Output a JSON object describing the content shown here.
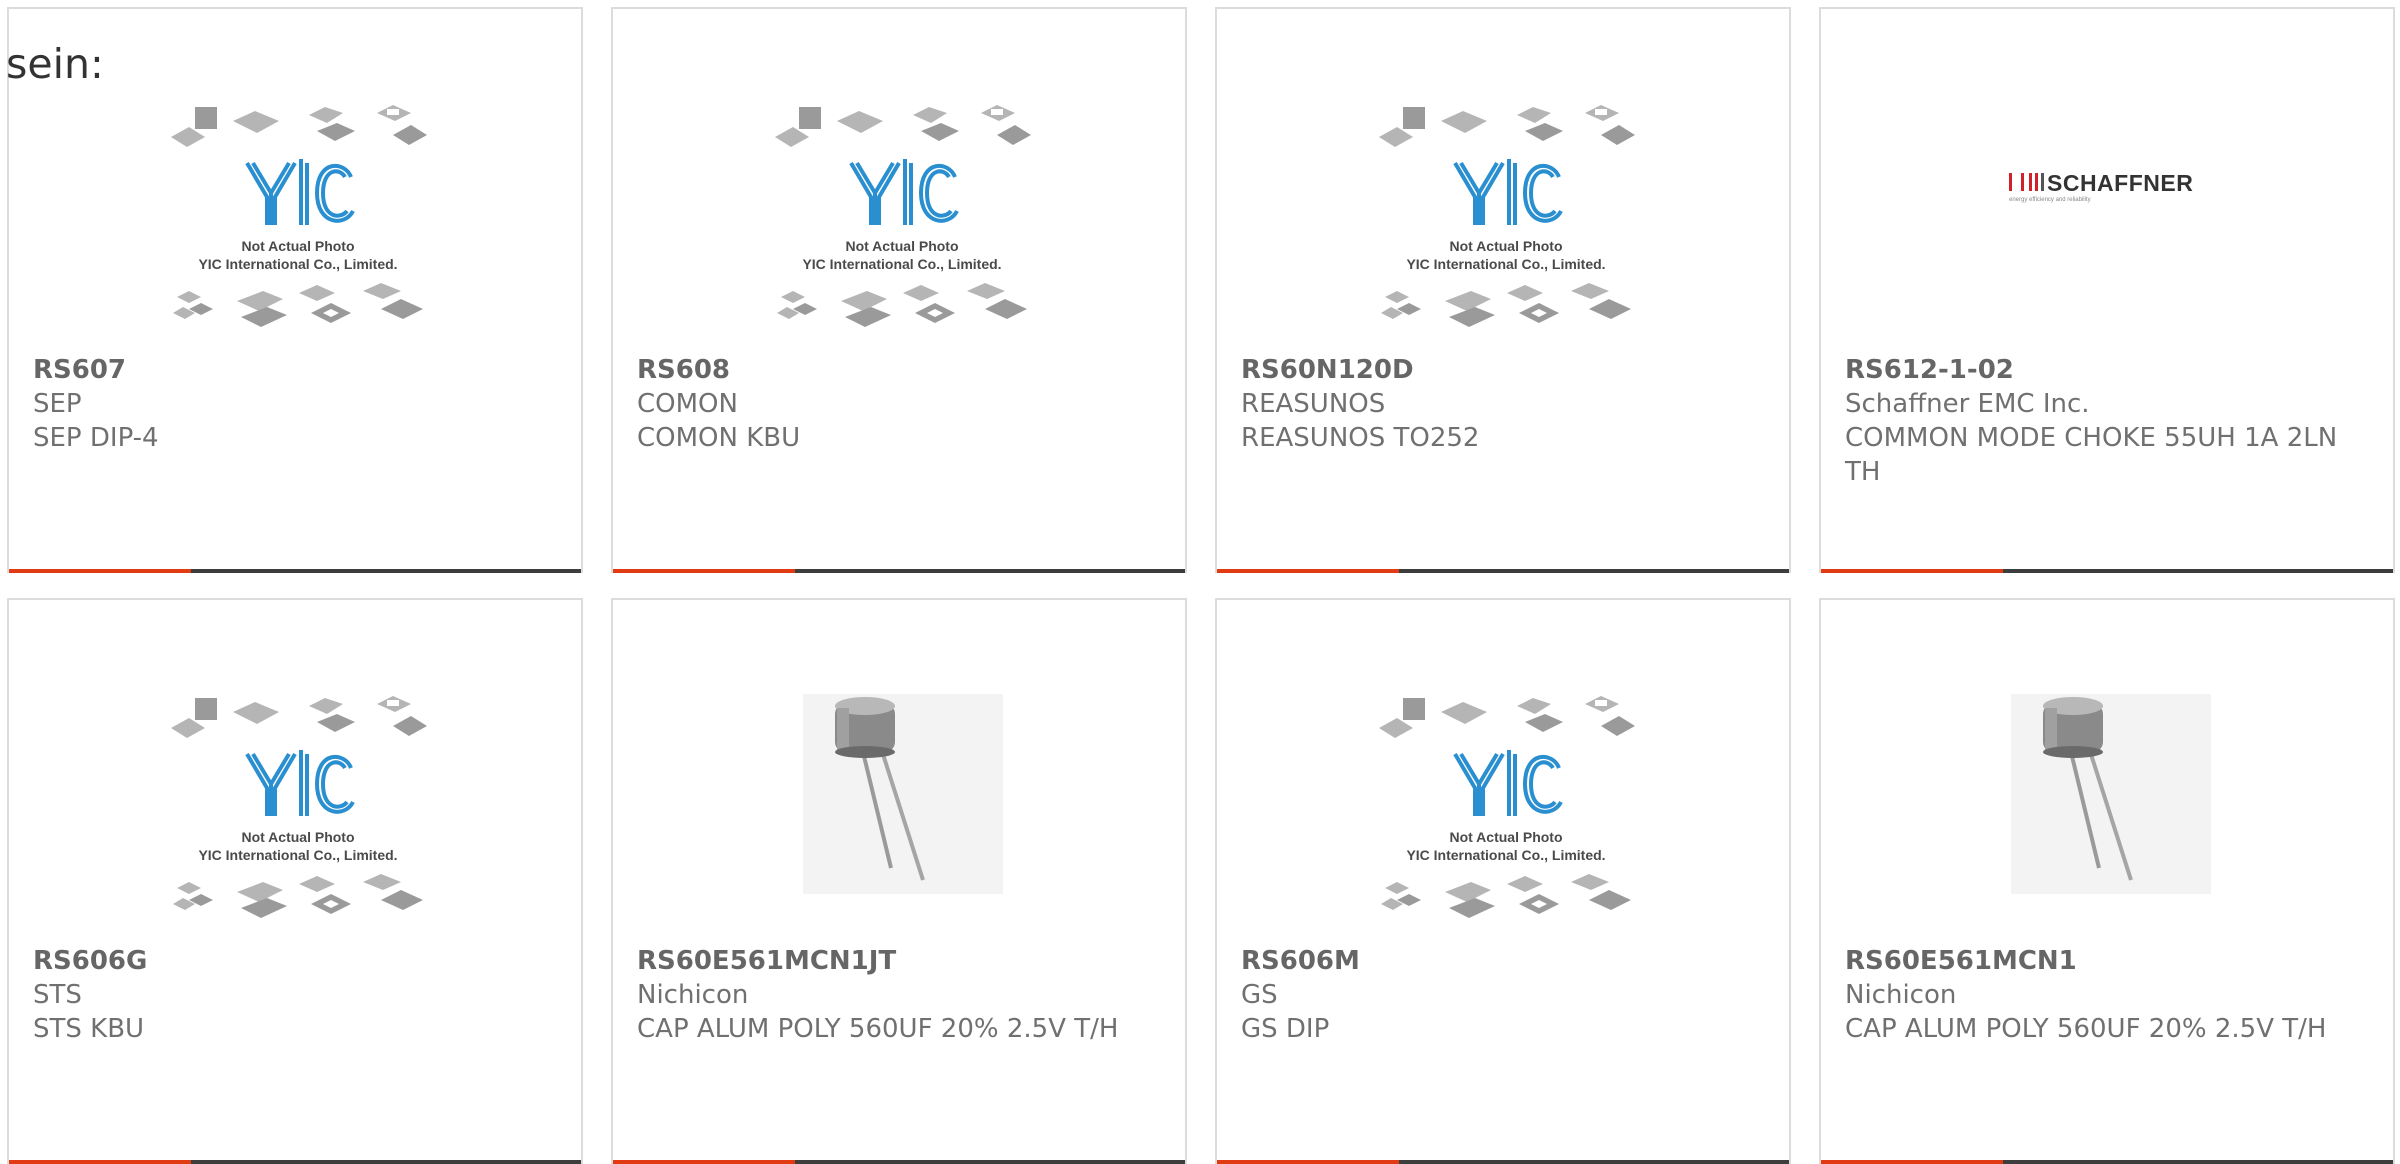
{
  "intro_text": "sein:",
  "placeholder_image": {
    "line1": "Not Actual Photo",
    "line2": "YIC International Co., Limited."
  },
  "schaffner_logo": {
    "wordmark": "SCHAFFNER",
    "tagline": "energy efficiency and reliability"
  },
  "products": [
    {
      "part": "RS607",
      "manufacturer": "SEP",
      "description": "SEP DIP-4",
      "image": "yic-placeholder"
    },
    {
      "part": "RS608",
      "manufacturer": "COMON",
      "description": "COMON KBU",
      "image": "yic-placeholder"
    },
    {
      "part": "RS60N120D",
      "manufacturer": "REASUNOS",
      "description": "REASUNOS TO252",
      "image": "yic-placeholder"
    },
    {
      "part": "RS612-1-02",
      "manufacturer": "Schaffner EMC Inc.",
      "description": "COMMON MODE CHOKE 55UH 1A 2LN TH",
      "image": "schaffner-logo"
    },
    {
      "part": "RS606G",
      "manufacturer": "STS",
      "description": "STS KBU",
      "image": "yic-placeholder"
    },
    {
      "part": "RS60E561MCN1JT",
      "manufacturer": "Nichicon",
      "description": "CAP ALUM POLY 560UF 20% 2.5V T/H",
      "image": "capacitor-photo"
    },
    {
      "part": "RS606M",
      "manufacturer": "GS",
      "description": "GS DIP",
      "image": "yic-placeholder"
    },
    {
      "part": "RS60E561MCN1",
      "manufacturer": "Nichicon",
      "description": "CAP ALUM POLY 560UF 20% 2.5V T/H",
      "image": "capacitor-photo"
    }
  ],
  "colors": {
    "accent": "#e03b12",
    "bar": "#3d3d3d",
    "border": "#dcdcdc",
    "yic_blue": "#2a8fd0",
    "schaffner_red": "#d0202a"
  }
}
